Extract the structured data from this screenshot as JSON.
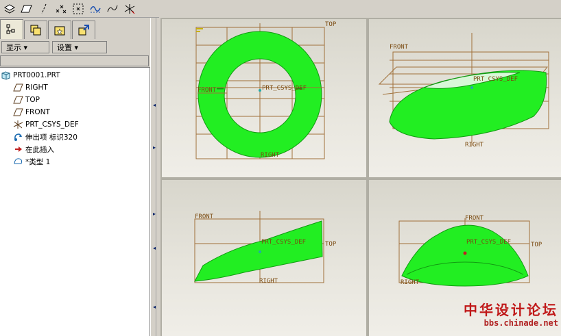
{
  "panel": {
    "menus": [
      {
        "label": "显示 ▾"
      },
      {
        "label": "设置 ▾"
      }
    ]
  },
  "tree": {
    "root": "PRT0001.PRT",
    "items": [
      {
        "label": "RIGHT",
        "icon": "datum-plane-icon"
      },
      {
        "label": "TOP",
        "icon": "datum-plane-icon"
      },
      {
        "label": "FRONT",
        "icon": "datum-plane-icon"
      },
      {
        "label": "PRT_CSYS_DEF",
        "icon": "coordinate-system-icon"
      },
      {
        "label": "伸出项 标识320",
        "icon": "protrusion-icon"
      },
      {
        "label": "在此插入",
        "icon": "insert-here-arrow-icon"
      },
      {
        "label": "*类型 1",
        "icon": "sketch-feature-icon"
      }
    ]
  },
  "viewports": {
    "top_left": {
      "front": "FRONT",
      "top": "TOP",
      "right": "RIGHT",
      "csys": "PRT_CSYS_DEF"
    },
    "top_right": {
      "front": "FRONT",
      "right": "RIGHT",
      "csys": "PRT_CSYS_DEF"
    },
    "bottom_left": {
      "front": "FRONT",
      "top": "TOP",
      "right": "RIGHT",
      "csys": "PRT_CSYS_DEF"
    },
    "bottom_right": {
      "front": "FRONT",
      "top": "TOP",
      "right": "RIGHT",
      "csys": "PRT_CSYS_DEF"
    }
  },
  "colors": {
    "model": "#22ee22",
    "datum": "#a0703a",
    "accent": "#0a246a"
  },
  "watermark": {
    "title": "中华设计论坛",
    "url": "bbs.chinade.net"
  }
}
